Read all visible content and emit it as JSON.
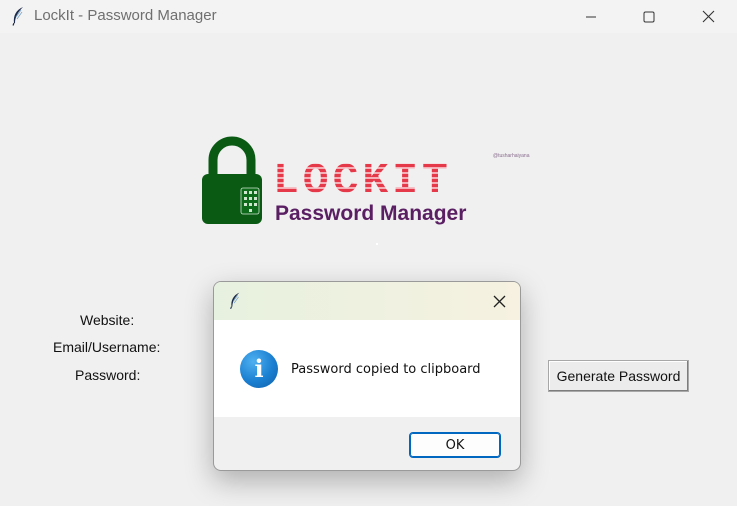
{
  "window": {
    "title": "LockIt - Password Manager",
    "icon": "feather-icon"
  },
  "logo": {
    "title": "LOCKIT",
    "subtitle": "Password Manager",
    "credit": "@tusharhaiyana"
  },
  "form": {
    "website_label": "Website:",
    "email_label": "Email/Username:",
    "password_label": "Password:",
    "generate_label": "Generate Password"
  },
  "dialog": {
    "icon": "info-icon",
    "message": "Password copied to clipboard",
    "ok_label": "OK"
  },
  "colors": {
    "logo_red": "#e5394a",
    "logo_purple": "#5a1e63",
    "lock_green": "#0a5a14",
    "accent_blue": "#0067c0"
  }
}
